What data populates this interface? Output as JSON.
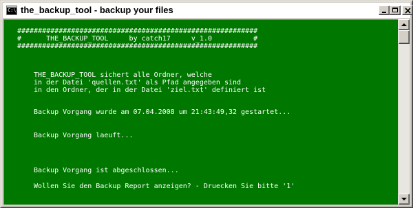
{
  "window": {
    "title": "the_backup_tool - backup your files",
    "icon_label": "C:\\"
  },
  "console": {
    "background_color": "#007800",
    "text_color": "#ffffff",
    "lines": [
      "##########################################################",
      "#      THE_BACKUP_TOOL     by catch17     v_1.0          #",
      "##########################################################",
      "THE_BACKUP_TOOL sichert alle Ordner, welche",
      "in der Datei 'quellen.txt' als Pfad angegeben sind",
      "in den Ordner, der in der Datei 'ziel.txt' definiert ist",
      "Backup Vorgang wurde am 07.04.2008 um 21:43:49,32 gestartet...",
      "Backup Vorgang laeuft...",
      "Backup Vorgang ist abgeschlossen...",
      "Wollen Sie den Backup Report anzeigen? - Druecken Sie bitte '1'"
    ]
  },
  "scrollbar": {
    "position": 0
  }
}
